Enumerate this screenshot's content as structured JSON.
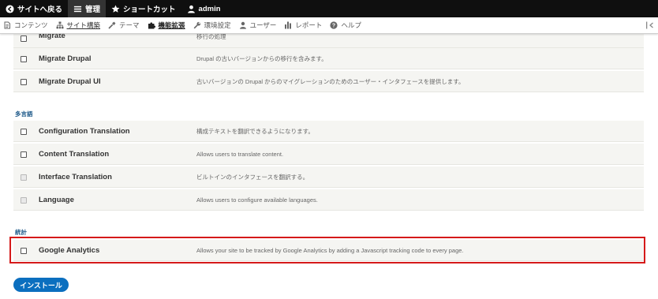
{
  "toolbar": {
    "back_label": "サイトへ戻る",
    "manage_label": "管理",
    "shortcuts_label": "ショートカット",
    "user_label": "admin"
  },
  "tray": {
    "items": [
      {
        "label": "コンテンツ",
        "icon": "content-icon"
      },
      {
        "label": "サイト構築",
        "icon": "structure-icon"
      },
      {
        "label": "テーマ",
        "icon": "appearance-icon"
      },
      {
        "label": "機能拡張",
        "icon": "extend-icon"
      },
      {
        "label": "環境設定",
        "icon": "config-icon"
      },
      {
        "label": "ユーザー",
        "icon": "people-icon"
      },
      {
        "label": "レポート",
        "icon": "reports-icon"
      },
      {
        "label": "ヘルプ",
        "icon": "help-icon"
      }
    ]
  },
  "modules": {
    "migrate": {
      "name": "Migrate",
      "desc": "移行の処理"
    },
    "migrate_drupal": {
      "name": "Migrate Drupal",
      "desc": "Drupal の古いバージョンからの移行を含みます。"
    },
    "migrate_drupal_ui": {
      "name": "Migrate Drupal UI",
      "desc": "古いバージョンの Drupal からのマイグレーションのためのユーザー・インタフェースを提供します。"
    },
    "config_translation": {
      "name": "Configuration Translation",
      "desc": "構成テキストを翻訳できるようになります。"
    },
    "content_translation": {
      "name": "Content Translation",
      "desc": "Allows users to translate content."
    },
    "interface_translation": {
      "name": "Interface Translation",
      "desc": "ビルトインのインタフェースを翻訳する。"
    },
    "language": {
      "name": "Language",
      "desc": "Allows users to configure available languages."
    },
    "google_analytics": {
      "name": "Google Analytics",
      "desc": "Allows your site to be tracked by Google Analytics by adding a Javascript tracking code to every page."
    }
  },
  "sections": {
    "multilingual": "多言語",
    "statistics": "統計"
  },
  "install_label": "インストール",
  "colors": {
    "toolbar_bg": "#0f0f0f",
    "highlight": "#d51a1a",
    "button": "#0b6fbf",
    "section_heading": "#1f5a8a"
  }
}
